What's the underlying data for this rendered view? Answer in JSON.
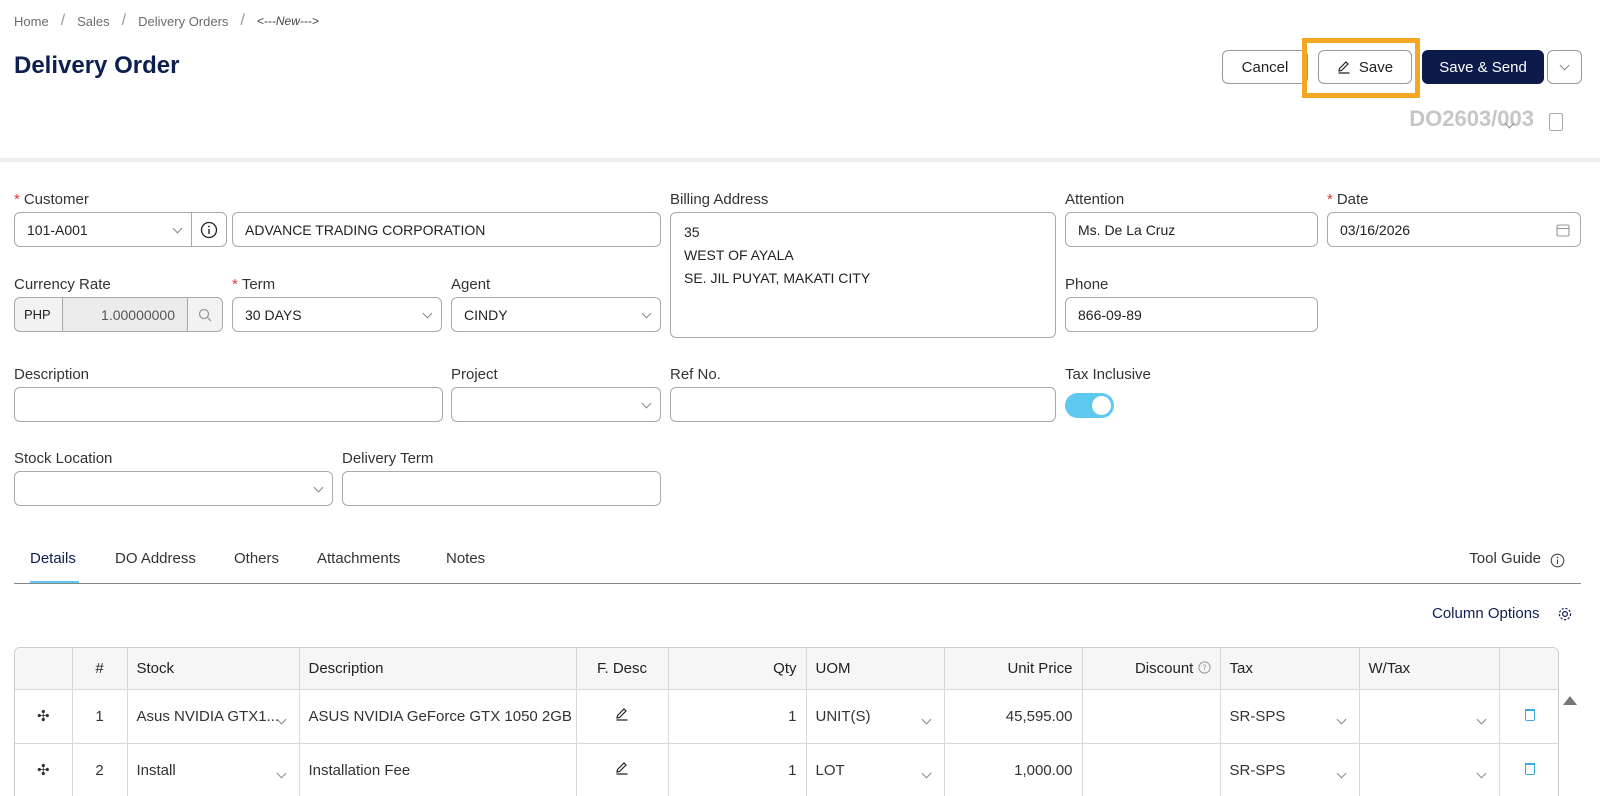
{
  "breadcrumb": [
    "Home",
    "Sales",
    "Delivery Orders",
    "<---New--->"
  ],
  "page_title": "Delivery Order",
  "actions": {
    "cancel": "Cancel",
    "save": "Save",
    "save_send": "Save & Send"
  },
  "doc_number": "DO2603/003",
  "form": {
    "customer": {
      "label": "Customer",
      "code": "101-A001",
      "name": "ADVANCE TRADING CORPORATION"
    },
    "billing_address": {
      "label": "Billing Address",
      "lines": [
        "35",
        "WEST OF AYALA",
        "SE. JIL PUYAT, MAKATI CITY"
      ]
    },
    "attention": {
      "label": "Attention",
      "value": "Ms. De La Cruz"
    },
    "date": {
      "label": "Date",
      "value": "03/16/2026"
    },
    "currency_rate": {
      "label": "Currency Rate",
      "currency": "PHP",
      "rate": "1.00000000"
    },
    "term": {
      "label": "Term",
      "value": "30 DAYS"
    },
    "agent": {
      "label": "Agent",
      "value": "CINDY"
    },
    "phone": {
      "label": "Phone",
      "value": "866-09-89"
    },
    "description": {
      "label": "Description",
      "value": ""
    },
    "project": {
      "label": "Project",
      "value": ""
    },
    "ref_no": {
      "label": "Ref No.",
      "value": ""
    },
    "tax_inclusive": {
      "label": "Tax Inclusive",
      "on": true
    },
    "stock_location": {
      "label": "Stock Location",
      "value": ""
    },
    "delivery_term": {
      "label": "Delivery Term",
      "value": ""
    }
  },
  "tabs": [
    "Details",
    "DO Address",
    "Others",
    "Attachments",
    "Notes"
  ],
  "tool_guide": "Tool Guide",
  "column_options": "Column Options",
  "grid": {
    "headers": [
      "#",
      "Stock",
      "Description",
      "F. Desc",
      "Qty",
      "UOM",
      "Unit Price",
      "Discount",
      "Tax",
      "W/Tax"
    ],
    "rows": [
      {
        "no": "1",
        "stock": "Asus NVIDIA GTX1...",
        "description": "ASUS NVIDIA GeForce GTX 1050 2GB",
        "qty": "1",
        "uom": "UNIT(S)",
        "unit_price": "45,595.00",
        "discount": "",
        "tax": "SR-SPS",
        "wtax": ""
      },
      {
        "no": "2",
        "stock": "Install",
        "description": "Installation Fee",
        "qty": "1",
        "uom": "LOT",
        "unit_price": "1,000.00",
        "discount": "",
        "tax": "SR-SPS",
        "wtax": ""
      }
    ]
  },
  "colors": {
    "primary": "#0d1b4a",
    "accent": "#5fc8ef",
    "highlight": "#f5a623",
    "required": "#e23b3b"
  }
}
